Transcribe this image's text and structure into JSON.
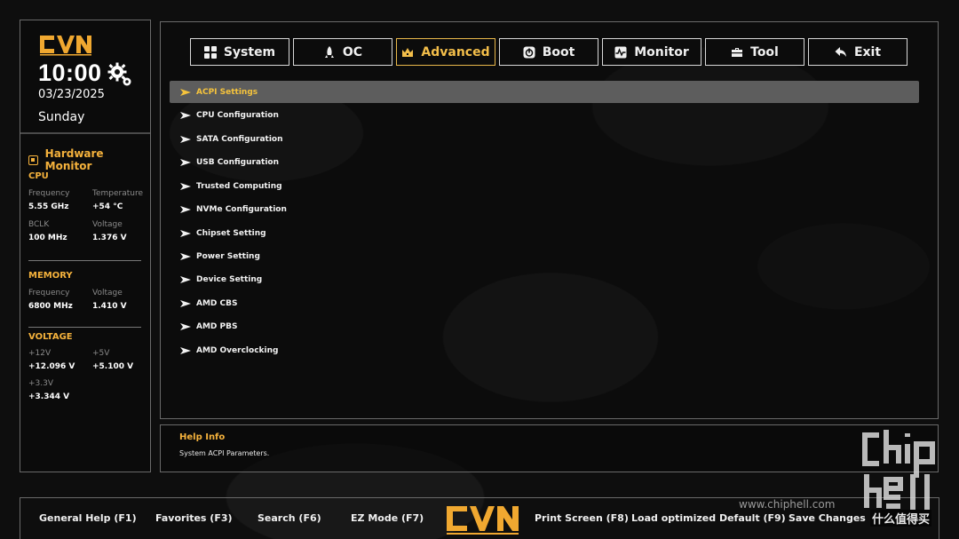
{
  "brand": "CVN",
  "clock": {
    "time": "10:00",
    "date": "03/23/2025",
    "day": "Sunday"
  },
  "hardware_monitor": {
    "title": "Hardware Monitor",
    "cpu": {
      "title": "CPU",
      "frequency_label": "Frequency",
      "frequency": "5.55 GHz",
      "temperature_label": "Temperature",
      "temperature": "+54 °C",
      "bclk_label": "BCLK",
      "bclk": "100 MHz",
      "voltage_label": "Voltage",
      "voltage": "1.376 V"
    },
    "memory": {
      "title": "MEMORY",
      "frequency_label": "Frequency",
      "frequency": "6800 MHz",
      "voltage_label": "Voltage",
      "voltage": "1.410 V"
    },
    "voltage": {
      "title": "VOLTAGE",
      "v12_label": "+12V",
      "v12": "+12.096 V",
      "v5_label": "+5V",
      "v5": "+5.100 V",
      "v33_label": "+3.3V",
      "v33": "+3.344 V"
    }
  },
  "tabs": [
    {
      "label": "System",
      "icon": "grid-icon"
    },
    {
      "label": "OC",
      "icon": "rocket-icon"
    },
    {
      "label": "Advanced",
      "icon": "crown-icon",
      "active": true
    },
    {
      "label": "Boot",
      "icon": "power-icon"
    },
    {
      "label": "Monitor",
      "icon": "pulse-icon"
    },
    {
      "label": "Tool",
      "icon": "toolbox-icon"
    },
    {
      "label": "Exit",
      "icon": "back-arrow-icon"
    }
  ],
  "menu": [
    {
      "label": "ACPI Settings",
      "selected": true
    },
    {
      "label": "CPU Configuration"
    },
    {
      "label": "SATA Configuration"
    },
    {
      "label": "USB Configuration"
    },
    {
      "label": "Trusted Computing"
    },
    {
      "label": "NVMe Configuration"
    },
    {
      "label": "Chipset Setting"
    },
    {
      "label": "Power Setting"
    },
    {
      "label": "Device Setting"
    },
    {
      "label": "AMD CBS"
    },
    {
      "label": "AMD PBS"
    },
    {
      "label": "AMD Overclocking"
    }
  ],
  "help": {
    "title": "Help Info",
    "text": "System ACPI Parameters."
  },
  "footer": {
    "general_help": "General Help (F1)",
    "favorites": "Favorites (F3)",
    "search": "Search (F6)",
    "ez_mode": "EZ Mode (F7)",
    "print_screen": "Print Screen (F8)",
    "load_default": "Load optimized Default (F9)",
    "save_changes": "Save Changes"
  },
  "watermarks": {
    "url": "www.chiphell.com",
    "site": "什么值得买"
  },
  "colors": {
    "accent": "#f5b23c",
    "selected_bg": "#5d5d5d",
    "border": "#6a6a6a"
  }
}
